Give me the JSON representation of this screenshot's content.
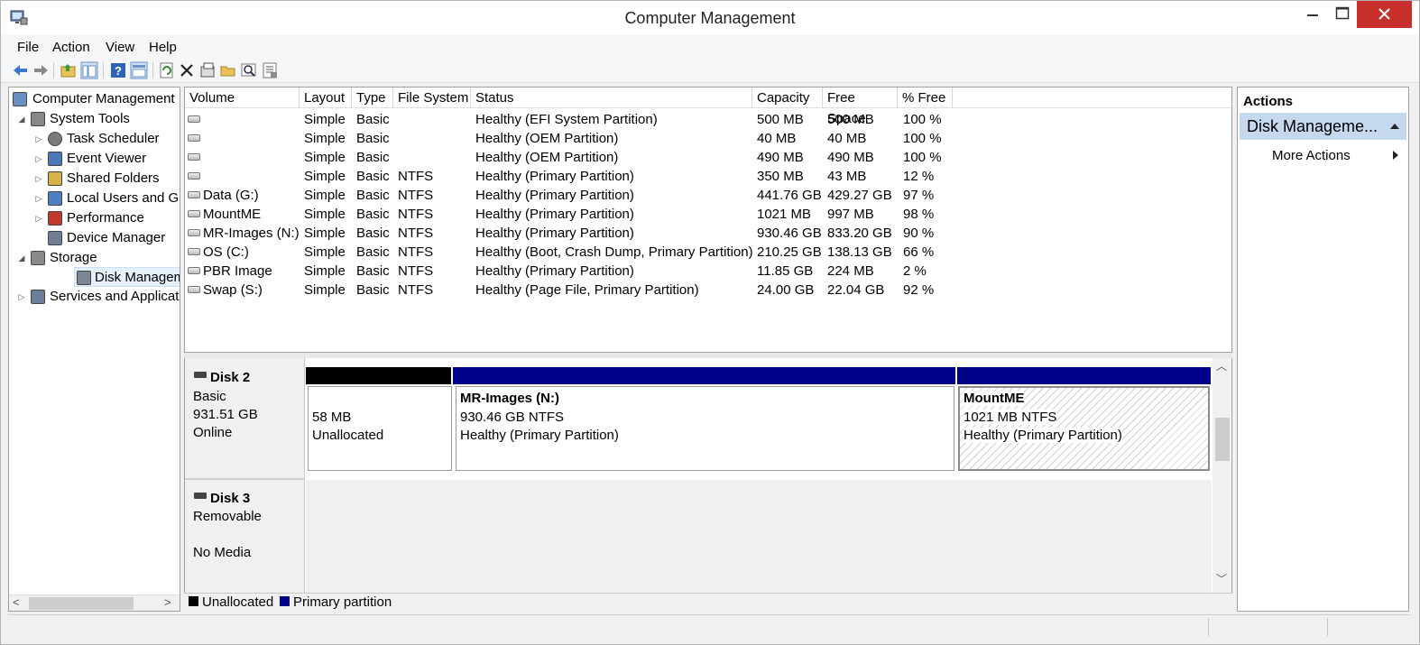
{
  "window": {
    "title": "Computer Management"
  },
  "menu": [
    "File",
    "Action",
    "View",
    "Help"
  ],
  "tree": {
    "items": [
      {
        "label": "Computer Management",
        "level": 0,
        "icon": "computer-management-icon"
      },
      {
        "label": "System Tools",
        "level": 1,
        "icon": "system-tools-icon"
      },
      {
        "label": "Task Scheduler",
        "level": 2,
        "icon": "clock-icon"
      },
      {
        "label": "Event Viewer",
        "level": 2,
        "icon": "event-viewer-icon"
      },
      {
        "label": "Shared Folders",
        "level": 2,
        "icon": "shared-folders-icon"
      },
      {
        "label": "Local Users and Gro",
        "level": 2,
        "icon": "users-icon"
      },
      {
        "label": "Performance",
        "level": 2,
        "icon": "performance-icon"
      },
      {
        "label": "Device Manager",
        "level": 2,
        "icon": "device-manager-icon"
      },
      {
        "label": "Storage",
        "level": 1,
        "icon": "storage-icon"
      },
      {
        "label": "Disk Management",
        "level": 2,
        "icon": "disk-management-icon"
      },
      {
        "label": "Services and Applicat",
        "level": 1,
        "icon": "services-icon"
      }
    ]
  },
  "volumes": {
    "columns": [
      "Volume",
      "Layout",
      "Type",
      "File System",
      "Status",
      "Capacity",
      "Free Space",
      "% Free"
    ],
    "rows": [
      [
        "",
        "Simple",
        "Basic",
        "",
        "Healthy (EFI System Partition)",
        "500 MB",
        "500 MB",
        "100 %"
      ],
      [
        "",
        "Simple",
        "Basic",
        "",
        "Healthy (OEM Partition)",
        "40 MB",
        "40 MB",
        "100 %"
      ],
      [
        "",
        "Simple",
        "Basic",
        "",
        "Healthy (OEM Partition)",
        "490 MB",
        "490 MB",
        "100 %"
      ],
      [
        "",
        "Simple",
        "Basic",
        "NTFS",
        "Healthy (Primary Partition)",
        "350 MB",
        "43 MB",
        "12 %"
      ],
      [
        "Data (G:)",
        "Simple",
        "Basic",
        "NTFS",
        "Healthy (Primary Partition)",
        "441.76 GB",
        "429.27 GB",
        "97 %"
      ],
      [
        "MountME",
        "Simple",
        "Basic",
        "NTFS",
        "Healthy (Primary Partition)",
        "1021 MB",
        "997 MB",
        "98 %"
      ],
      [
        "MR-Images (N:)",
        "Simple",
        "Basic",
        "NTFS",
        "Healthy (Primary Partition)",
        "930.46 GB",
        "833.20 GB",
        "90 %"
      ],
      [
        "OS (C:)",
        "Simple",
        "Basic",
        "NTFS",
        "Healthy (Boot, Crash Dump, Primary Partition)",
        "210.25 GB",
        "138.13 GB",
        "66 %"
      ],
      [
        "PBR Image",
        "Simple",
        "Basic",
        "NTFS",
        "Healthy (Primary Partition)",
        "11.85 GB",
        "224 MB",
        "2 %"
      ],
      [
        "Swap (S:)",
        "Simple",
        "Basic",
        "NTFS",
        "Healthy (Page File, Primary Partition)",
        "24.00 GB",
        "22.04 GB",
        "92 %"
      ]
    ]
  },
  "disks": {
    "disk2": {
      "name": "Disk 2",
      "type": "Basic",
      "size": "931.51 GB",
      "state": "Online",
      "partitions": [
        {
          "line1": "",
          "line2": "58 MB",
          "line3": "Unallocated"
        },
        {
          "line1": "MR-Images  (N:)",
          "line2": "930.46 GB NTFS",
          "line3": "Healthy (Primary Partition)"
        },
        {
          "line1": "MountME",
          "line2": "1021 MB NTFS",
          "line3": "Healthy (Primary Partition)"
        }
      ]
    },
    "disk3": {
      "name": "Disk 3",
      "type": "Removable",
      "state": "No Media"
    }
  },
  "legend": {
    "unallocated": "Unallocated",
    "primary": "Primary partition"
  },
  "colors": {
    "unallocated": "#000000",
    "primary": "#00008b",
    "close_button": "#c7302b",
    "actions_header": "#c6d8ee"
  },
  "actions": {
    "title": "Actions",
    "section": "Disk Manageme...",
    "more": "More Actions"
  }
}
